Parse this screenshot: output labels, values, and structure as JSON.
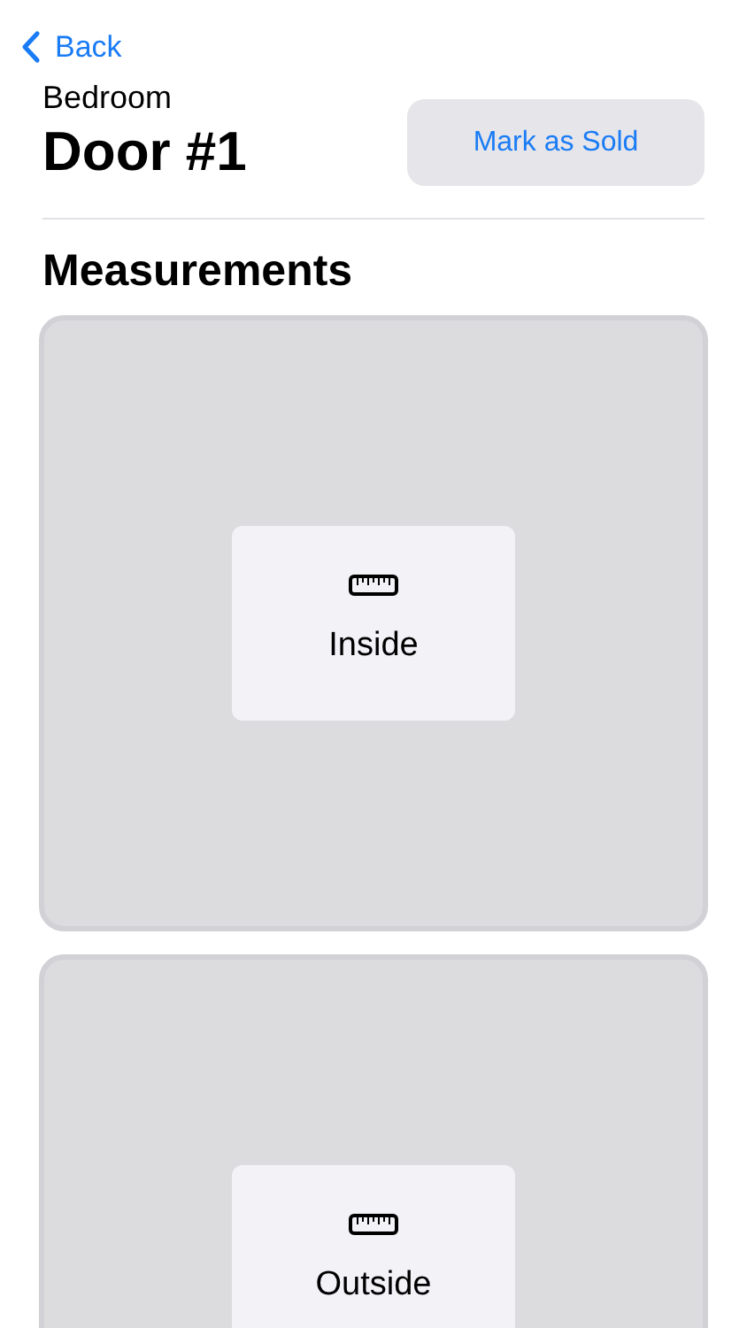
{
  "nav": {
    "back": "Back"
  },
  "header": {
    "subtitle": "Bedroom",
    "title": "Door #1",
    "action": "Mark as Sold"
  },
  "section": {
    "title": "Measurements"
  },
  "measurements": [
    {
      "label": "Inside"
    },
    {
      "label": "Outside"
    }
  ]
}
